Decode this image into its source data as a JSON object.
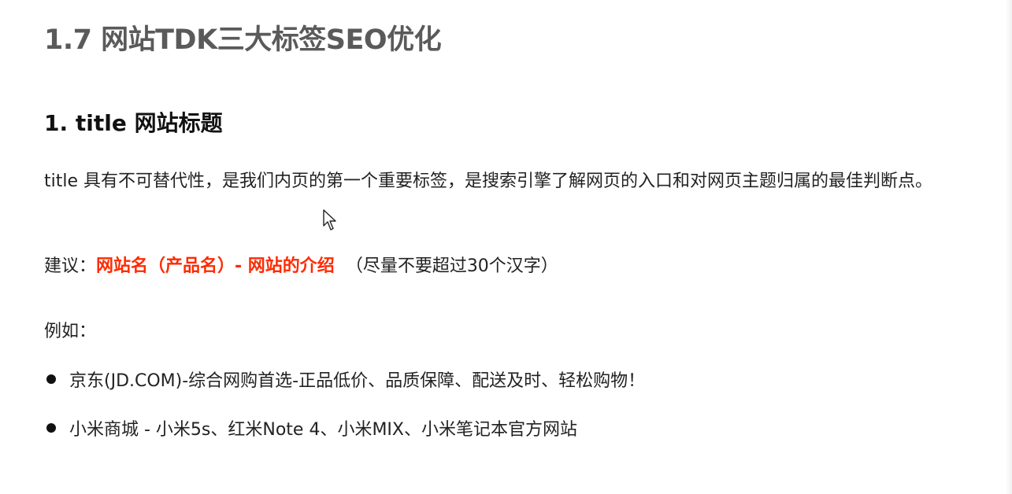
{
  "heading_main": "1.7 网站TDK三大标签SEO优化",
  "heading_section": "1. title 网站标题",
  "paragraph": "title 具有不可替代性，是我们内页的第一个重要标签，是搜索引擎了解网页的入口和对网页主题归属的最佳判断点。",
  "suggestion": {
    "label": "建议：",
    "highlight": "网站名（产品名）- 网站的介绍",
    "note": "（尽量不要超过30个汉字）",
    "highlight_color": "#ff2a00"
  },
  "example_label": "例如：",
  "examples": [
    "京东(JD.COM)-综合网购首选-正品低价、品质保障、配送及时、轻松购物！",
    "小米商城 - 小米5s、红米Note 4、小米MIX、小米笔记本官方网站"
  ],
  "cursor_icon": "mouse-pointer-icon"
}
